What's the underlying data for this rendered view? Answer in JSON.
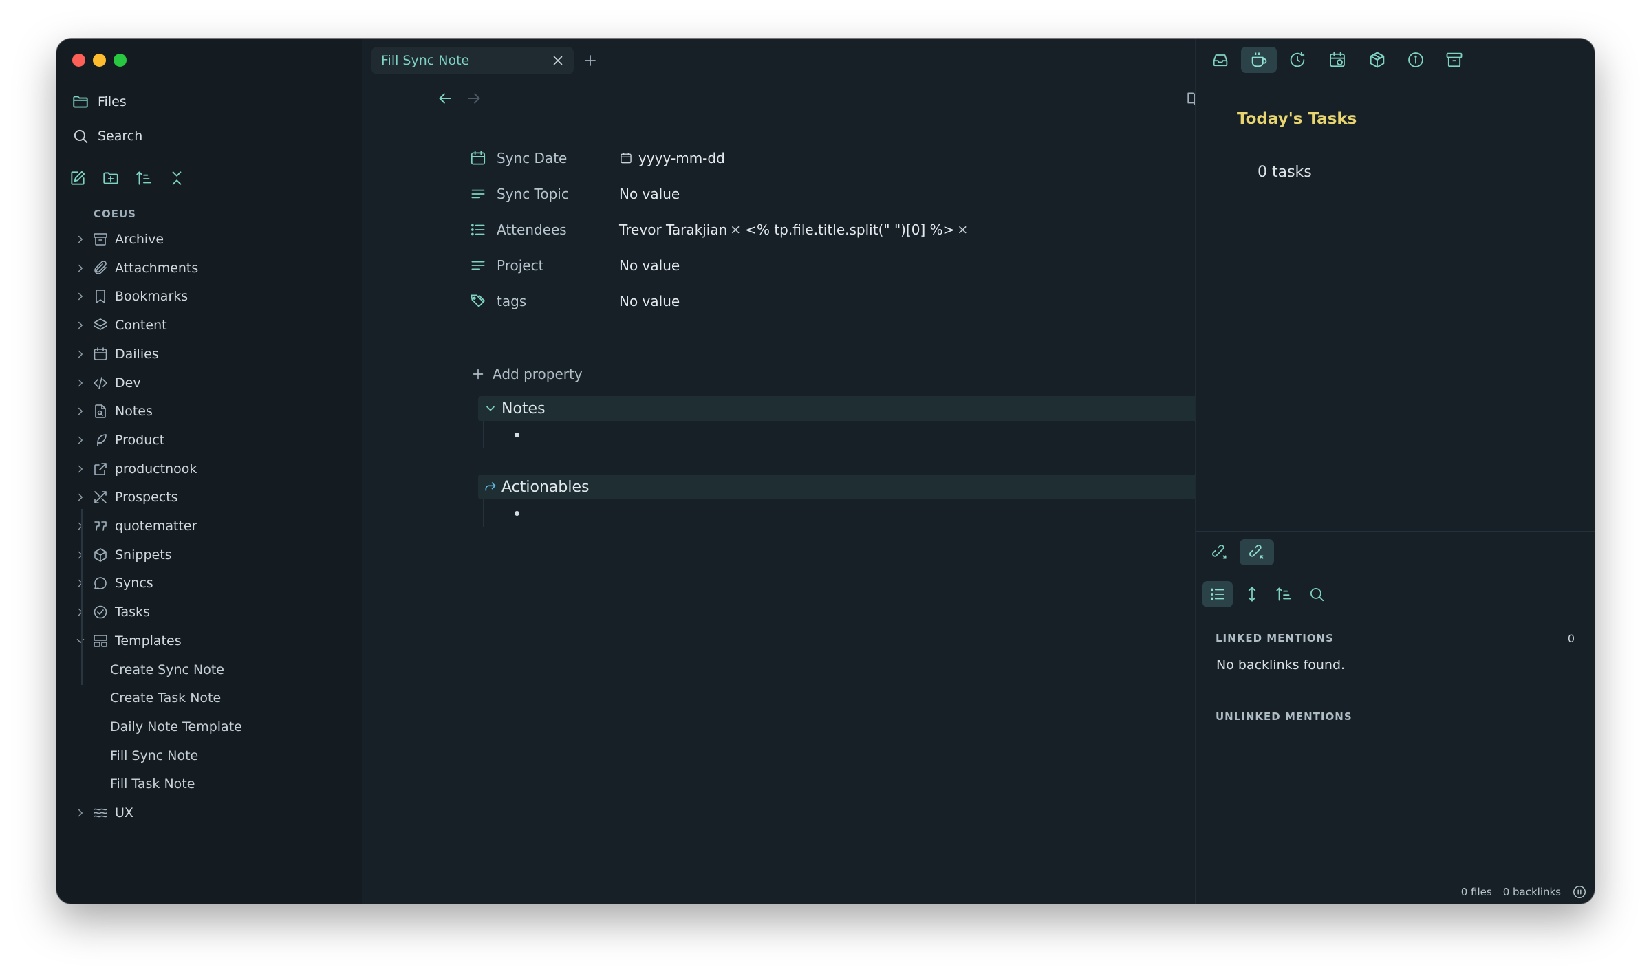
{
  "sidebar": {
    "files_label": "Files",
    "search_label": "Search",
    "vault_name": "COEUS",
    "folders": [
      {
        "label": "Archive",
        "icon": "archive-icon"
      },
      {
        "label": "Attachments",
        "icon": "paperclip-icon"
      },
      {
        "label": "Bookmarks",
        "icon": "bookmark-icon"
      },
      {
        "label": "Content",
        "icon": "layers-icon"
      },
      {
        "label": "Dailies",
        "icon": "calendar-icon"
      },
      {
        "label": "Dev",
        "icon": "code-icon"
      },
      {
        "label": "Notes",
        "icon": "file-search-icon"
      },
      {
        "label": "Product",
        "icon": "feather-icon"
      },
      {
        "label": "productnook",
        "icon": "external-link-icon"
      },
      {
        "label": "Prospects",
        "icon": "tools-icon"
      },
      {
        "label": "quotematter",
        "icon": "quote-icon"
      },
      {
        "label": "Snippets",
        "icon": "package-icon"
      },
      {
        "label": "Syncs",
        "icon": "message-circle-icon"
      },
      {
        "label": "Tasks",
        "icon": "check-circle-icon"
      },
      {
        "label": "Templates",
        "icon": "layout-template-icon"
      }
    ],
    "template_files": [
      "Create Sync Note",
      "Create Task Note",
      "Daily Note Template",
      "Fill Sync Note",
      "Fill Task Note"
    ],
    "last_folder": {
      "label": "UX",
      "icon": "waves-icon"
    }
  },
  "editor": {
    "tab_title": "Fill Sync Note",
    "properties": [
      {
        "key": "Sync Date",
        "value": "yyyy-mm-dd"
      },
      {
        "key": "Sync Topic",
        "value": "No value"
      },
      {
        "key": "Attendees",
        "values": [
          "Trevor Tarakjian",
          "<% tp.file.title.split(\" \")[0] %>"
        ]
      },
      {
        "key": "Project",
        "value": "No value"
      },
      {
        "key": "tags",
        "value": "No value"
      }
    ],
    "add_property": "Add property",
    "callouts": [
      {
        "title": "Notes"
      },
      {
        "title": "Actionables"
      }
    ]
  },
  "right_panel": {
    "tasks_title": "Today's Tasks",
    "tasks_count": "0 tasks",
    "linked_mentions": "LINKED MENTIONS",
    "linked_count": "0",
    "no_backlinks": "No backlinks found.",
    "unlinked_mentions": "UNLINKED MENTIONS"
  },
  "statusbar": {
    "files": "0 files",
    "backlinks": "0 backlinks"
  },
  "colors": {
    "accent": "#7fd3c3",
    "tasks_title": "#e8d56f",
    "background": "#172027",
    "sidebar_bg": "#141c22"
  }
}
